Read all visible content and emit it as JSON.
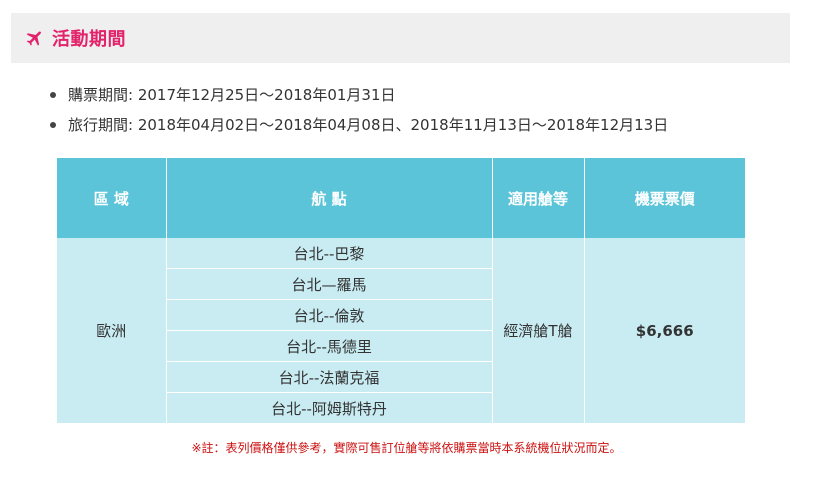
{
  "section": {
    "icon": "airplane-icon",
    "title": "活動期間",
    "accent_color": "#e2226b",
    "background_color": "#efefef"
  },
  "periods": [
    "購票期間: 2017年12月25日～2018年01月31日",
    "旅行期間: 2018年04月02日～2018年04月08日、2018年11月13日～2018年12月13日"
  ],
  "table": {
    "header_color": "#5bc4d9",
    "row_color": "#c8ecf2",
    "headers": [
      "區 域",
      "航 點",
      "適用艙等",
      "機票票價"
    ],
    "region": "歐洲",
    "routes": [
      "台北--巴黎",
      "台北—羅馬",
      "台北--倫敦",
      "台北--馬德里",
      "台北--法蘭克福",
      "台北--阿姆斯特丹"
    ],
    "cabin": "經濟艙T艙",
    "price": "$6,666",
    "price_color": "#cc1111"
  },
  "note": "※註：表列價格僅供參考，實際可售訂位艙等將依購票當時本系統機位狀況而定。"
}
